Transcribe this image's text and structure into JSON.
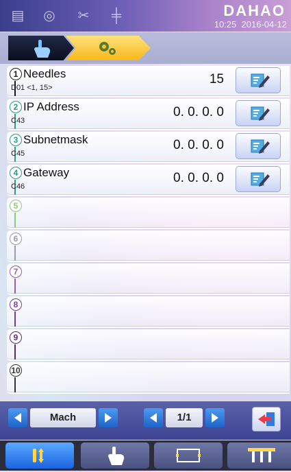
{
  "header": {
    "brand": "DAHAO",
    "time": "10:25",
    "date": "2016-04-12"
  },
  "params": [
    {
      "num": "1",
      "label": "Needles",
      "code": "D01 <1, 15>",
      "value": "15"
    },
    {
      "num": "2",
      "label": "IP Address",
      "code": "C43",
      "value": "0. 0. 0. 0"
    },
    {
      "num": "3",
      "label": "Subnetmask",
      "code": "C45",
      "value": "0. 0. 0. 0"
    },
    {
      "num": "4",
      "label": "Gateway",
      "code": "C46",
      "value": "0. 0. 0. 0"
    },
    {
      "num": "5"
    },
    {
      "num": "6"
    },
    {
      "num": "7"
    },
    {
      "num": "8"
    },
    {
      "num": "9"
    },
    {
      "num": "10"
    }
  ],
  "nav": {
    "category": "Mach",
    "page": "1/1"
  },
  "colors": {
    "num_colors": [
      "#1a1a1a",
      "#2a9a8a",
      "#2a9a8a",
      "#2a9a8a",
      "#8fc87a",
      "#9a9aa8",
      "#9a5bb0",
      "#7a3a9a",
      "#5a2a6a",
      "#333333"
    ]
  },
  "icons": {
    "status": [
      "machine-icon",
      "bobbin-icon",
      "thread-cut-icon",
      "needle-bar-icon"
    ],
    "tabs": [
      "hand-icon",
      "gear-icon"
    ],
    "dock": [
      "needle-updown-icon",
      "hand-touch-icon",
      "frame-icon",
      "needles-icon"
    ]
  }
}
